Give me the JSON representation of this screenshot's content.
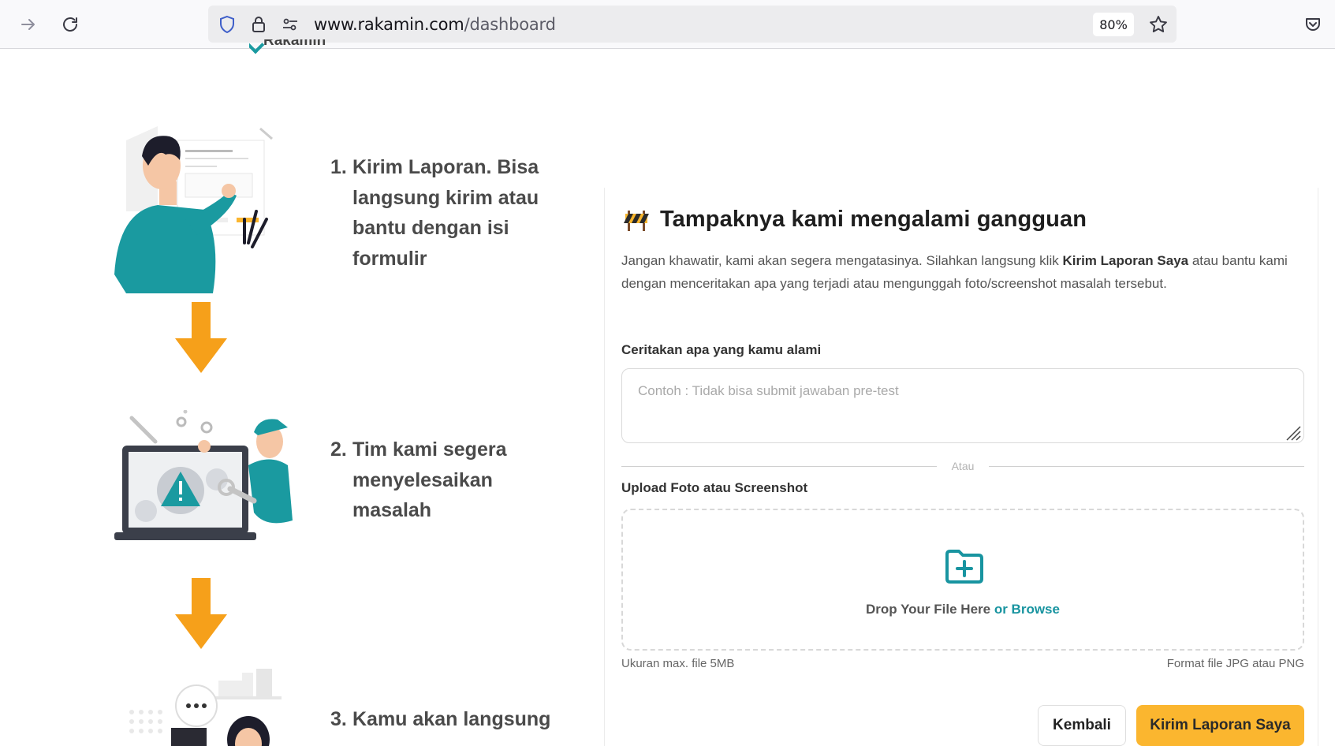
{
  "browser": {
    "url_host": "www.rakamin.com",
    "url_path": "/dashboard",
    "zoom": "80%"
  },
  "page": {
    "logo_text": "Rakamin",
    "steps": [
      {
        "number": "1.",
        "text": "Kirim Laporan. Bisa langsung kirim atau bantu dengan isi formulir"
      },
      {
        "number": "2.",
        "text": "Tim kami segera menyelesaikan masalah"
      },
      {
        "number": "3.",
        "text": "Kamu akan langsung"
      }
    ]
  },
  "report": {
    "title": "Tampaknya kami mengalami gangguan",
    "desc_before": "Jangan khawatir, kami akan segera mengatasinya. Silahkan langsung klik ",
    "desc_bold": "Kirim Laporan Saya",
    "desc_after": " atau bantu kami dengan menceritakan apa yang terjadi atau mengunggah foto/screenshot masalah tersebut.",
    "story_label": "Ceritakan apa yang kamu alami",
    "story_placeholder": "Contoh : Tidak bisa submit jawaban pre-test",
    "divider_text": "Atau",
    "upload_label": "Upload Foto atau Screenshot",
    "drop_text": "Drop Your File Here",
    "browse_text": "or Browse",
    "max_size_hint": "Ukuran max. file 5MB",
    "format_hint": "Format file JPG atau PNG",
    "back_button": "Kembali",
    "submit_button": "Kirim Laporan Saya"
  },
  "colors": {
    "accent_teal": "#1894a0",
    "submit_yellow": "#fbb62f",
    "arrow_orange": "#f6a01a"
  },
  "icons": [
    "back-arrow-icon",
    "forward-arrow-icon",
    "reload-icon",
    "shield-icon",
    "lock-icon",
    "permissions-icon",
    "bookmark-star-icon",
    "pocket-icon",
    "warning-barrier-icon",
    "folder-add-icon",
    "down-arrow-icon"
  ]
}
